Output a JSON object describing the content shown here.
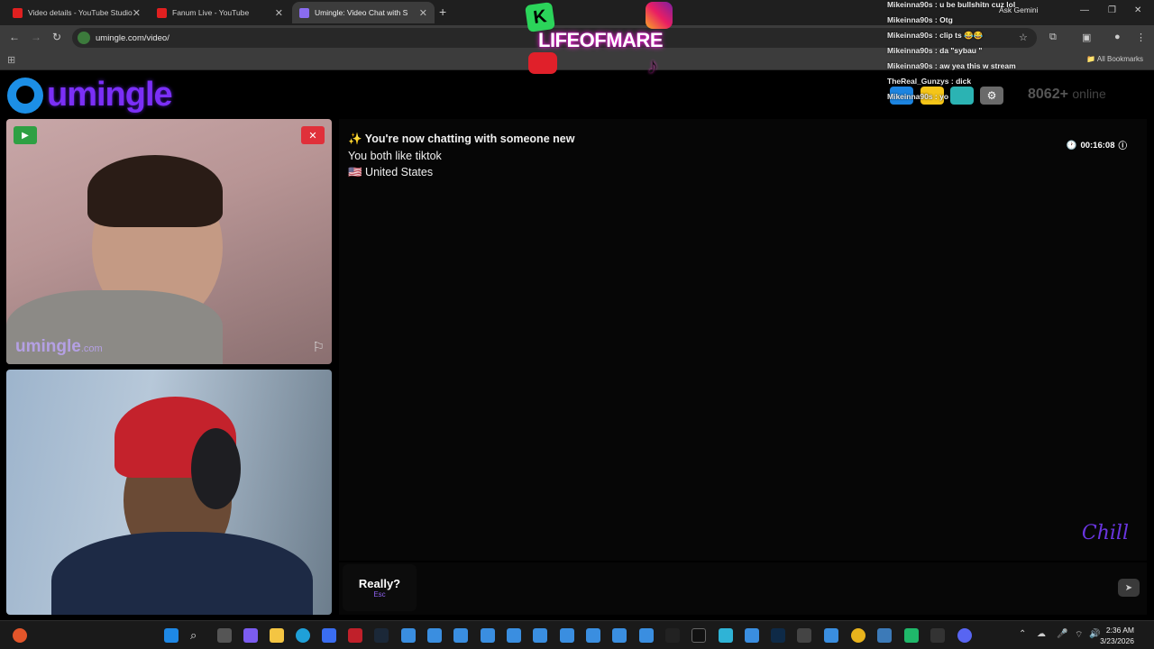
{
  "browser": {
    "tabs": [
      {
        "title": "Video details - YouTube Studio",
        "favicon_color": "#e02020"
      },
      {
        "title": "Fanum Live - YouTube",
        "favicon_color": "#e02020"
      },
      {
        "title": "Umingle: Video Chat with S",
        "favicon_color": "#8a6cf0"
      }
    ],
    "url": "umingle.com/video/",
    "ask_gemini": "Ask Gemini",
    "all_bookmarks": "All Bookmarks"
  },
  "site": {
    "logo_text": "umingle",
    "online_count": "8062+",
    "online_label": "online",
    "header_buttons": [
      {
        "name": "gift",
        "color": "#1c84e0"
      },
      {
        "name": "badge",
        "color": "#f5c518"
      },
      {
        "name": "language",
        "color": "#2bb3b3"
      },
      {
        "name": "settings",
        "color": "#6a6a6a"
      }
    ]
  },
  "video": {
    "watermark": "umingle",
    "watermark_suffix": ".com"
  },
  "chat": {
    "messages": [
      "✨ You're now chatting with someone new",
      "You both like tiktok",
      "🇺🇸 United States"
    ],
    "timer": "00:16:08",
    "signature": "Chill"
  },
  "controls": {
    "skip_label": "Really?",
    "skip_hint": "Esc",
    "message_placeholder": ""
  },
  "overlay": {
    "banner_text": "LIFEOFMARE",
    "k_badge": "K"
  },
  "stream_chat": [
    {
      "user": "Mikeinna90s",
      "text": "u be bullshitn cuz lol"
    },
    {
      "user": "Mikeinna90s",
      "text": "Otg"
    },
    {
      "user": "Mikeinna90s",
      "text": "clip ts 😂😂"
    },
    {
      "user": "Mikeinna90s",
      "text": "da \"sybau \""
    },
    {
      "user": "Mikeinna90s",
      "text": "aw yea this w stream"
    },
    {
      "user": "TheReal_Gunzys",
      "text": "dick"
    },
    {
      "user": "Mikeinna90s",
      "text": "yo"
    }
  ],
  "taskbar": {
    "time": "2:36 AM",
    "date": "3/23/2026"
  }
}
